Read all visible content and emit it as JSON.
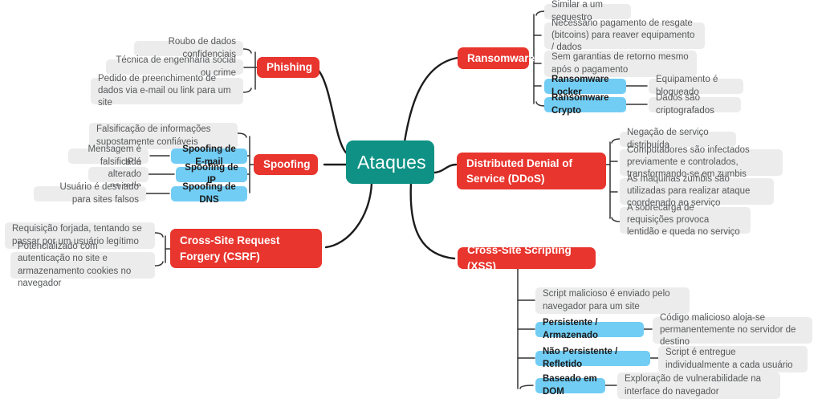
{
  "diagram": {
    "title": "Ataques",
    "type": "mind-map",
    "colors": {
      "root": "#0f9285",
      "branch": "#e8352e",
      "sub": "#72cdf4",
      "leaf": "#ececec",
      "leaf_text": "#56585a",
      "edge": "#1c1c1c",
      "background": "#ffffff"
    }
  },
  "root": {
    "label": "Ataques"
  },
  "branches": {
    "phishing": {
      "label": "Phishing",
      "leaves": [
        "Roubo de dados confidenciais",
        "Técnica de engenharia social ou crime",
        "Pedido de preenchimento de dados via e-mail ou link para um site"
      ]
    },
    "spoofing": {
      "label": "Spoofing",
      "leaves": [
        "Falsificação de informações supostamente confiáveis"
      ],
      "subs": [
        {
          "label": "Spoofing de E-mail",
          "leaf": "Mensagem é falsificada"
        },
        {
          "label": "Spoofing de IP",
          "leaf": "IP é alterado na rede"
        },
        {
          "label": "Spoofing de DNS",
          "leaf": "Usuário é desviado para sites falsos"
        }
      ]
    },
    "csrf": {
      "label": "Cross-Site Request Forgery (CSRF)",
      "leaves": [
        "Requisição forjada, tentando se passar por um usuário legítimo",
        "Potencializado com autenticação no site e armazenamento cookies no navegador"
      ]
    },
    "ransomware": {
      "label": "Ransomware",
      "leaves": [
        "Similar a um sequestro",
        "Necessário pagamento de resgate (bitcoins) para reaver equipamento / dados",
        "Sem garantias de retorno mesmo após o pagamento"
      ],
      "subs": [
        {
          "label": "Ransomware Locker",
          "leaf": "Equipamento é bloqueado"
        },
        {
          "label": "Ransomware Crypto",
          "leaf": "Dados são criptografados"
        }
      ]
    },
    "ddos": {
      "label": "Distributed Denial of Service (DDoS)",
      "leaves": [
        "Negação de serviço distribuída",
        "Computadores são infectados previamente e controlados, transformando-se em zumbis",
        "As máquinas zumbis são utilizadas para realizar ataque coordenado ao serviço",
        "A sobrecarga de requisições provoca lentidão e queda no serviço"
      ]
    },
    "xss": {
      "label": "Cross-Site Scripting (XSS)",
      "leaves": [
        "Script malicioso é enviado pelo navegador para um site"
      ],
      "subs": [
        {
          "label": "Persistente / Armazenado",
          "leaf": "Código malicioso aloja-se permanentemente no servidor de destino"
        },
        {
          "label": "Não Persistente / Refletido",
          "leaf": "Script é entregue individualmente a cada usuário"
        },
        {
          "label": "Baseado em DOM",
          "leaf": "Exploração de vulnerabilidade na interface do navegador"
        }
      ]
    }
  }
}
